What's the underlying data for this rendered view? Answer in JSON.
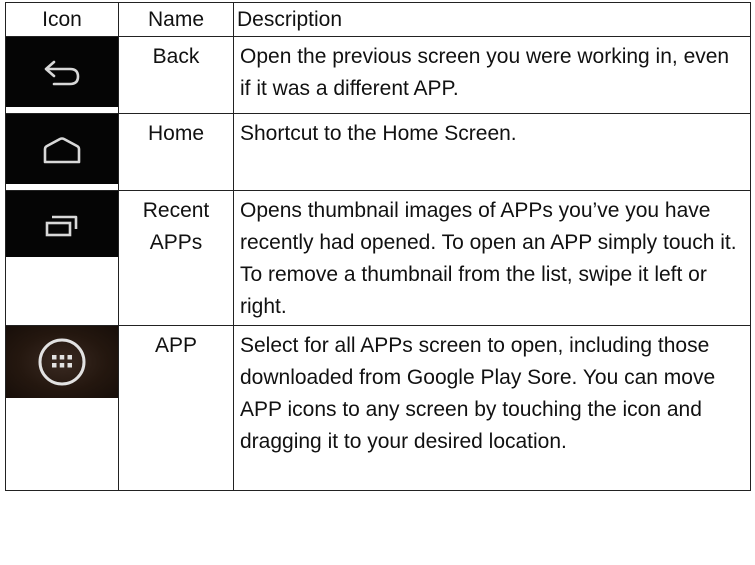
{
  "table": {
    "headers": {
      "icon": "Icon",
      "name": "Name",
      "description": "Description"
    },
    "rows": [
      {
        "icon": "back-arrow-icon",
        "name": "Back",
        "description": "Open the previous screen you were working in, even if it was a different APP."
      },
      {
        "icon": "home-icon",
        "name": "Home",
        "description": "Shortcut to the Home Screen."
      },
      {
        "icon": "recent-apps-icon",
        "name_line1": "Recent",
        "name_line2": "APPs",
        "description": "Opens thumbnail images of APPs you’ve you have recently had opened. To open an APP simply touch it. To remove a thumbnail from the list, swipe it left or right."
      },
      {
        "icon": "app-drawer-icon",
        "name": "APP",
        "description": "Select for all APPs screen to open,  including those downloaded from Google Play Sore. You can move APP icons to any screen by touching the icon and dragging it to your desired location."
      }
    ]
  },
  "colors": {
    "icon_tile_bg": "#050505",
    "icon_stroke": "#d8d8d8",
    "border": "#222222"
  }
}
